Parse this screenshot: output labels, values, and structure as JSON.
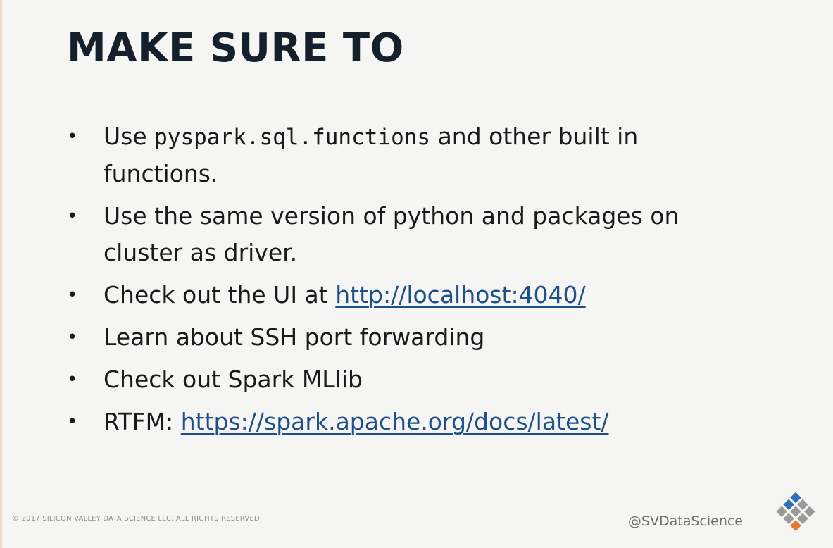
{
  "slide": {
    "title": "MAKE SURE TO",
    "bullets": {
      "b1": {
        "pre": "Use ",
        "code": "pyspark.sql.functions",
        "post": " and other built in functions."
      },
      "b2": {
        "text": "Use the same version of python and packages on cluster as driver."
      },
      "b3": {
        "pre": "Check out the UI at ",
        "link": "http://localhost:4040/"
      },
      "b4": {
        "text": "Learn about SSH port forwarding"
      },
      "b5": {
        "text": "Check out Spark MLlib"
      },
      "b6": {
        "pre": "RTFM: ",
        "link": "https://spark.apache.org/docs/latest/"
      }
    },
    "bullet_glyph": "•"
  },
  "footer": {
    "copyright": "© 2017 SILICON VALLEY DATA SCIENCE LLC. ALL RIGHTS RESERVED.",
    "handle": "@SVDataScience"
  },
  "colors": {
    "title": "#14202b",
    "link": "#1f4f8a",
    "logo_blue": "#2f6fb5",
    "logo_gray": "#9a9a9a",
    "logo_orange": "#e8772e"
  },
  "icons": {
    "logo": "svds-diamond-logo"
  }
}
